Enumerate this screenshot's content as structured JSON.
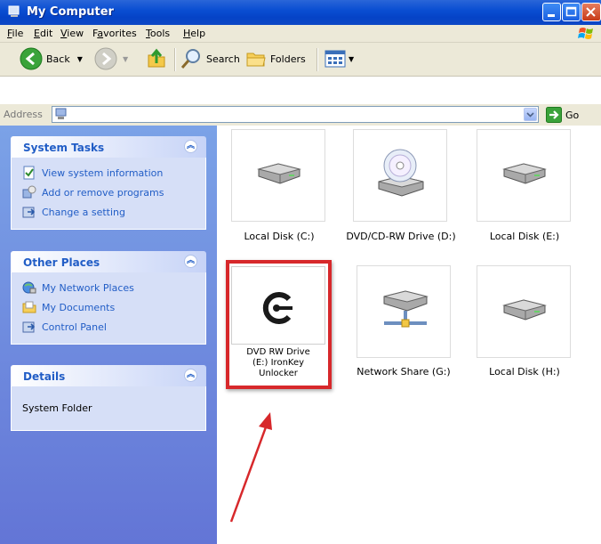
{
  "window": {
    "title": "My Computer"
  },
  "menu": [
    {
      "u": "F",
      "rest": "ile"
    },
    {
      "u": "E",
      "rest": "dit"
    },
    {
      "u": "V",
      "rest": "iew"
    },
    {
      "pre": "F",
      "u": "a",
      "rest": "vorites"
    },
    {
      "u": "T",
      "rest": "ools"
    },
    {
      "u": "H",
      "rest": "elp"
    }
  ],
  "toolbar": {
    "back": "Back",
    "search": "Search",
    "folders": "Folders"
  },
  "address": {
    "label": "Address",
    "go": "Go"
  },
  "system_tasks": {
    "title": "System Tasks",
    "items": [
      "View system information",
      "Add or remove programs",
      "Change a setting"
    ]
  },
  "other_places": {
    "title": "Other Places",
    "items": [
      "My Network Places",
      "My Documents",
      "Control Panel"
    ]
  },
  "details": {
    "title": "Details",
    "text": "System Folder"
  },
  "drives": [
    {
      "label": "Local Disk (C:)",
      "icon": "hard-disk-icon"
    },
    {
      "label": "DVD/CD-RW Drive (D:)",
      "icon": "cd-drive-icon"
    },
    {
      "label": "Local Disk (E:)",
      "icon": "hard-disk-icon"
    },
    {
      "label": "DVD RW Drive (E:) IronKey Unlocker",
      "line1": "DVD RW Drive",
      "line2": "(E:) IronKey",
      "line3": "Unlocker",
      "icon": "ironkey-icon"
    },
    {
      "label": "Network Share (G:)",
      "icon": "network-drive-icon"
    },
    {
      "label": "Local Disk (H:)",
      "icon": "hard-disk-icon"
    }
  ],
  "colors": {
    "highlight": "#d7282b",
    "titlebar": "#0a4ed2",
    "taskpane": "#7ba2e7",
    "link": "#215dc6"
  }
}
